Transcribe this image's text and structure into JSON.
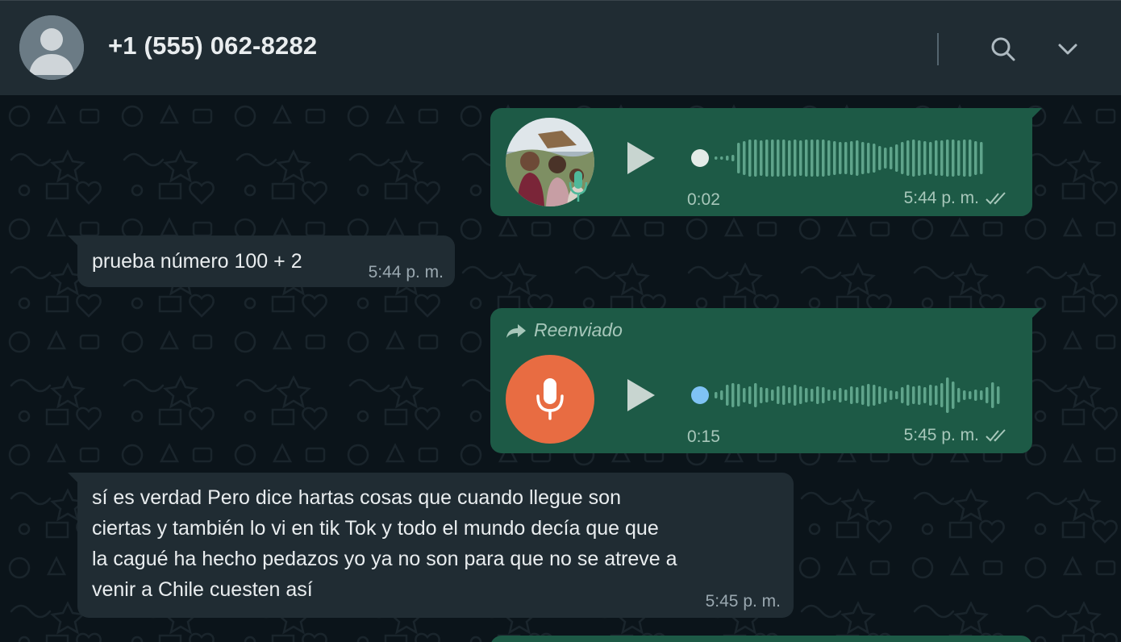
{
  "header": {
    "contact": "+1 (555) 062-8282",
    "avatar_icon": "default-avatar-icon",
    "search_icon": "search-icon",
    "menu_icon": "chevron-down-icon"
  },
  "colors": {
    "header_bg": "#202c33",
    "chat_bg": "#0b141a",
    "outgoing_bubble": "#1d5a46",
    "incoming_bubble": "#202c33",
    "voice_mic_orange": "#e86c42",
    "unplayed_dot": "#7fc3f5"
  },
  "messages": [
    {
      "type": "voice",
      "direction": "out",
      "duration": "0:02",
      "time": "5:44 p. m.",
      "status": "delivered-double-check",
      "progress": 0
    },
    {
      "type": "text",
      "direction": "in",
      "text": "prueba número 100 + 2",
      "time": "5:44 p. m."
    },
    {
      "type": "voice",
      "direction": "out",
      "forwarded_label": "Reenviado",
      "duration": "0:15",
      "time": "5:45 p. m.",
      "status": "delivered-double-check",
      "progress": 0
    },
    {
      "type": "text",
      "direction": "in",
      "lines": [
        "sí es verdad Pero dice hartas cosas que cuando llegue son",
        "ciertas y también lo vi en tik Tok y todo el mundo decía que que",
        "la cagué ha hecho pedazos yo ya no son para que no se atreve a",
        "venir a Chile cuesten así"
      ],
      "time": "5:45 p. m."
    }
  ]
}
